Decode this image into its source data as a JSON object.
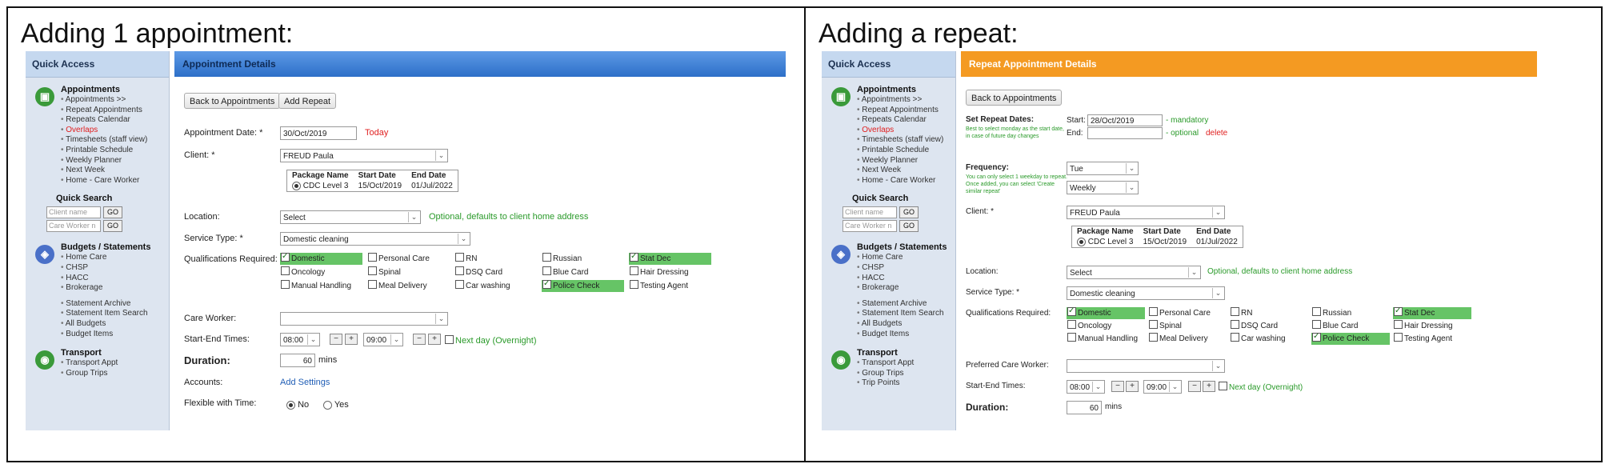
{
  "panels": {
    "left": {
      "caption": "Adding 1 appointment:",
      "header": "Appointment Details",
      "buttons": {
        "back": "Back to Appointments",
        "add_repeat": "Add Repeat"
      },
      "appointment_date_label": "Appointment Date: *",
      "appointment_date_value": "30/Oct/2019",
      "today_link": "Today",
      "client_label": "Client: *",
      "client_value": "FREUD Paula",
      "package": {
        "headers": [
          "Package Name",
          "Start Date",
          "End Date"
        ],
        "row": [
          "CDC Level 3",
          "15/Oct/2019",
          "01/Jul/2022"
        ]
      },
      "location_label": "Location:",
      "location_value": "Select",
      "location_hint": "Optional, defaults to client home address",
      "service_label": "Service Type: *",
      "service_value": "Domestic cleaning",
      "qual_label": "Qualifications Required:",
      "care_worker_label": "Care Worker:",
      "start_end_label": "Start-End Times:",
      "start_time": "08:00",
      "end_time": "09:00",
      "next_day": "Next day (Overnight)",
      "duration_label": "Duration:",
      "duration_value": "60",
      "duration_unit": "mins",
      "accounts_label": "Accounts:",
      "accounts_link": "Add Settings",
      "flexible_label": "Flexible with Time:",
      "flex_no": "No",
      "flex_yes": "Yes"
    },
    "right": {
      "caption": "Adding a repeat:",
      "header": "Repeat Appointment Details",
      "buttons": {
        "back": "Back to Appointments"
      },
      "set_repeat_label": "Set Repeat Dates:",
      "set_repeat_note": "Best to select monday as the start date, in case of future day changes",
      "start_label": "Start:",
      "start_value": "28/Oct/2019",
      "mandatory": "- mandatory",
      "end_label": "End:",
      "optional": "- optional",
      "delete": "delete",
      "frequency_label": "Frequency:",
      "frequency_note": "You can only select 1 weekday to repeat. Once added, you can select 'Create similar repeat'",
      "weekday_value": "Tue",
      "frequency_value": "Weekly",
      "client_label": "Client: *",
      "client_value": "FREUD Paula",
      "package": {
        "headers": [
          "Package Name",
          "Start Date",
          "End Date"
        ],
        "row": [
          "CDC Level 3",
          "15/Oct/2019",
          "01/Jul/2022"
        ]
      },
      "location_label": "Location:",
      "location_value": "Select",
      "location_hint": "Optional, defaults to client home address",
      "service_label": "Service Type: *",
      "service_value": "Domestic cleaning",
      "qual_label": "Qualifications Required:",
      "care_worker_label": "Preferred Care Worker:",
      "start_end_label": "Start-End Times:",
      "start_time": "08:00",
      "end_time": "09:00",
      "next_day": "Next day (Overnight)",
      "duration_label": "Duration:",
      "duration_value": "60",
      "duration_unit": "mins"
    }
  },
  "qualifications": [
    {
      "label": "Domestic",
      "checked": true
    },
    {
      "label": "Personal Care",
      "checked": false
    },
    {
      "label": "RN",
      "checked": false
    },
    {
      "label": "Russian",
      "checked": false
    },
    {
      "label": "Stat Dec",
      "checked": true
    },
    {
      "label": "Oncology",
      "checked": false
    },
    {
      "label": "Spinal",
      "checked": false
    },
    {
      "label": "DSQ Card",
      "checked": false
    },
    {
      "label": "Blue Card",
      "checked": false
    },
    {
      "label": "Hair Dressing",
      "checked": false
    },
    {
      "label": "Manual Handling",
      "checked": false
    },
    {
      "label": "Meal Delivery",
      "checked": false
    },
    {
      "label": "Car washing",
      "checked": false
    },
    {
      "label": "Police Check",
      "checked": true
    },
    {
      "label": "Testing Agent",
      "checked": false
    }
  ],
  "quick_access": {
    "title": "Quick Access",
    "appointments_title": "Appointments",
    "appointments_links_left": [
      "Appointments >>",
      "Repeat Appointments",
      "Repeats Calendar",
      "Overlaps",
      "Timesheets (staff view)",
      "Printable Schedule",
      "Weekly Planner",
      "Next Week",
      "Home - Care Worker"
    ],
    "appointments_links_right": [
      "Appointments >>",
      "Repeat Appointments",
      "Repeats Calendar",
      "Overlaps",
      "Timesheets (staff view)",
      "Printable Schedule",
      "Weekly Planner",
      "Next Week",
      "Home - Care Worker"
    ],
    "quick_search_title": "Quick Search",
    "client_name_placeholder": "Client name",
    "care_worker_placeholder_left": "Care Worker n",
    "care_worker_placeholder_right": "Care Worker n",
    "go": "GO",
    "budgets_title": "Budgets / Statements",
    "budget_links_a": [
      "Home Care",
      "CHSP",
      "HACC",
      "Brokerage"
    ],
    "budget_links_b": [
      "Statement Archive",
      "Statement Item Search",
      "All Budgets",
      "Budget Items"
    ],
    "transport_title": "Transport",
    "transport_links_left": [
      "Transport Appt",
      "Group Trips"
    ],
    "transport_links_right": [
      "Transport Appt",
      "Group Trips",
      "Trip Points"
    ]
  }
}
